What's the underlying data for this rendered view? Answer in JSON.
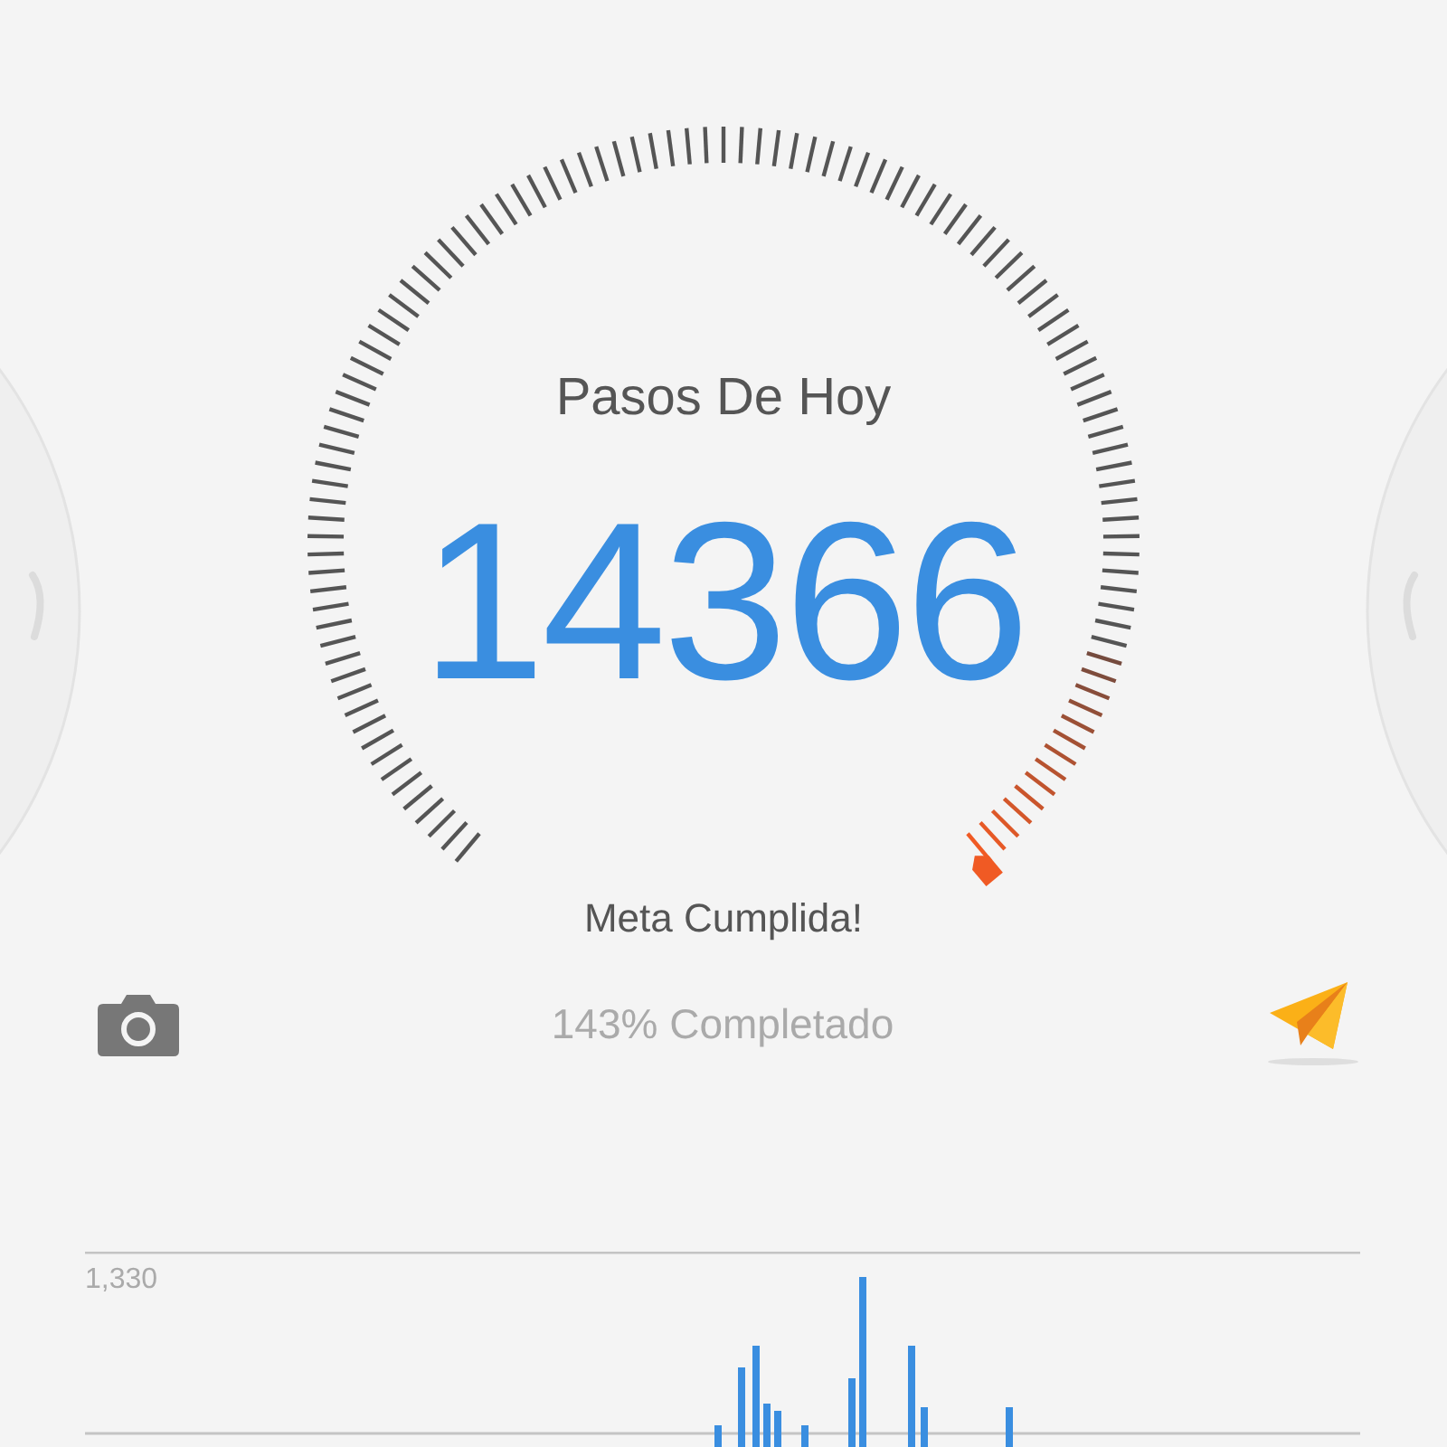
{
  "gauge": {
    "title": "Pasos De Hoy",
    "steps": "14366",
    "status": "Meta Cumplida!"
  },
  "progress": {
    "text": "143% Completado"
  },
  "chart": {
    "top_label": "1,330"
  }
}
